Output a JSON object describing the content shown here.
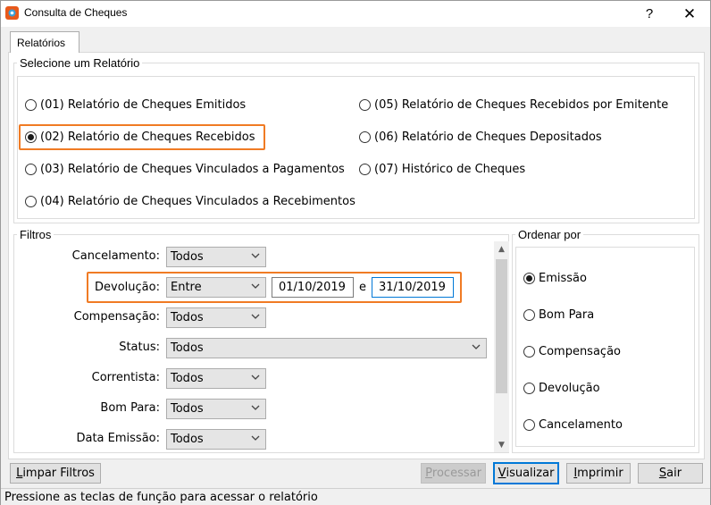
{
  "window": {
    "title": "Consulta de Cheques",
    "help_label": "?",
    "close_label": "✕"
  },
  "tabs": [
    {
      "label": "Relatórios",
      "active": true
    }
  ],
  "report_group": {
    "label": "Selecione um Relatório",
    "options": [
      {
        "label": "(01) Relatório de Cheques Emitidos",
        "selected": false
      },
      {
        "label": "(02) Relatório de Cheques Recebidos",
        "selected": true
      },
      {
        "label": "(03) Relatório de Cheques Vinculados a Pagamentos",
        "selected": false
      },
      {
        "label": "(04) Relatório de Cheques Vinculados a Recebimentos",
        "selected": false
      },
      {
        "label": "(05) Relatório de Cheques Recebidos por Emitente",
        "selected": false
      },
      {
        "label": "(06) Relatório de Cheques Depositados",
        "selected": false
      },
      {
        "label": "(07) Histórico de Cheques",
        "selected": false
      }
    ]
  },
  "filters": {
    "label": "Filtros",
    "cancelamento": {
      "label": "Cancelamento:",
      "value": "Todos"
    },
    "devolucao": {
      "label": "Devolução:",
      "value": "Entre",
      "from": "01/10/2019",
      "and": "e",
      "to": "31/10/2019"
    },
    "compensacao": {
      "label": "Compensação:",
      "value": "Todos"
    },
    "status": {
      "label": "Status:",
      "value": "Todos"
    },
    "correntista": {
      "label": "Correntista:",
      "value": "Todos"
    },
    "bom_para": {
      "label": "Bom Para:",
      "value": "Todos"
    },
    "data_emissao": {
      "label": "Data Emissão:",
      "value": "Todos"
    }
  },
  "order": {
    "label": "Ordenar por",
    "options": [
      {
        "label": "Emissão",
        "selected": true
      },
      {
        "label": "Bom Para",
        "selected": false
      },
      {
        "label": "Compensação",
        "selected": false
      },
      {
        "label": "Devolução",
        "selected": false
      },
      {
        "label": "Cancelamento",
        "selected": false
      }
    ]
  },
  "buttons": {
    "limpar": {
      "first": "L",
      "rest": "impar Filtros"
    },
    "processar": {
      "first": "P",
      "rest": "rocessar"
    },
    "visualizar": {
      "first": "V",
      "rest": "isualizar"
    },
    "imprimir": {
      "first": "I",
      "rest": "mprimir"
    },
    "sair": {
      "first": "S",
      "rest": "air"
    }
  },
  "status_bar": "Pressione as teclas de função para acessar o relatório",
  "colors": {
    "highlight": "#f07b24",
    "focus": "#0078d7"
  }
}
